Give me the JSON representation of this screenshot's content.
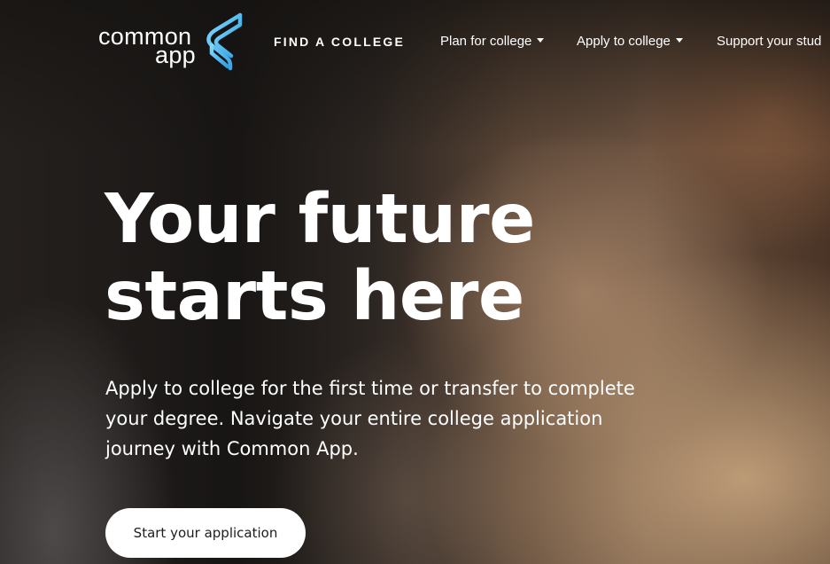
{
  "logo": {
    "line1": "common",
    "line2": "app",
    "icon": "common-app-logo-mark"
  },
  "nav": {
    "find_college": "FIND A COLLEGE",
    "plan_for_college": "Plan for college",
    "apply_to_college": "Apply to college",
    "support_students": "Support your stud"
  },
  "hero": {
    "title_line1": "Your future",
    "title_line2": "starts here",
    "description": "Apply to college for the first time or transfer to complete your degree. Navigate your entire college application journey with Common App.",
    "cta_label": "Start your application"
  },
  "colors": {
    "logo_accent": "#4fc3f7",
    "button_bg": "#ffffff",
    "button_text": "#1d1d1d",
    "text": "#ffffff"
  }
}
